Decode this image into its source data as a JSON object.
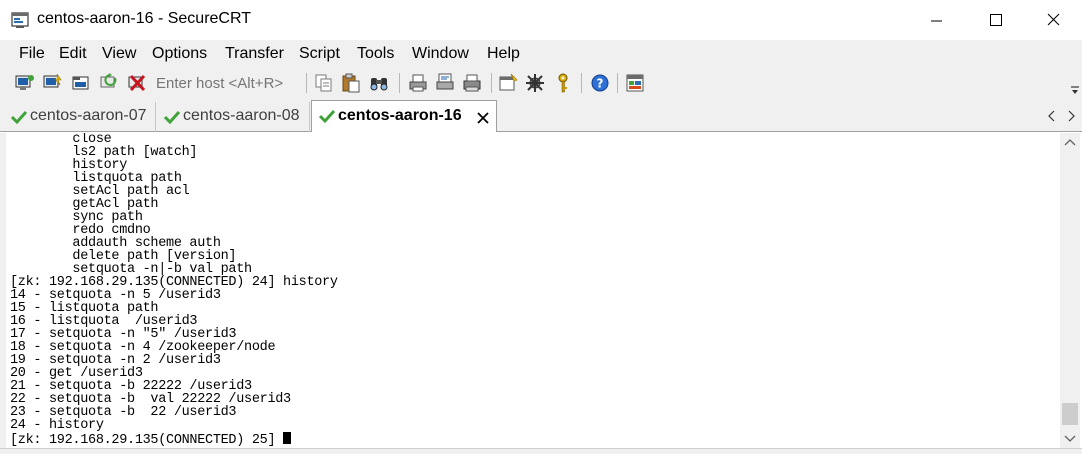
{
  "window": {
    "title": "centos-aaron-16 - SecureCRT"
  },
  "menu": [
    "File",
    "Edit",
    "View",
    "Options",
    "Transfer",
    "Script",
    "Tools",
    "Window",
    "Help"
  ],
  "toolbar": {
    "host_placeholder": "Enter host <Alt+R>"
  },
  "tabs": [
    {
      "label": "centos-aaron-07",
      "active": false,
      "connected": true
    },
    {
      "label": "centos-aaron-08",
      "active": false,
      "connected": true
    },
    {
      "label": "centos-aaron-16",
      "active": true,
      "connected": true
    }
  ],
  "terminal": {
    "lines": [
      "        close",
      "        ls2 path [watch]",
      "        history",
      "        listquota path",
      "        setAcl path acl",
      "        getAcl path",
      "        sync path",
      "        redo cmdno",
      "        addauth scheme auth",
      "        delete path [version]",
      "        setquota -n|-b val path",
      "[zk: 192.168.29.135(CONNECTED) 24] history",
      "14 - setquota -n 5 /userid3",
      "15 - listquota path",
      "16 - listquota  /userid3",
      "17 - setquota -n \"5\" /userid3",
      "18 - setquota -n 4 /zookeeper/node",
      "19 - setquota -n 2 /userid3",
      "20 - get /userid3",
      "21 - setquota -b 22222 /userid3",
      "22 - setquota -b  val 22222 /userid3",
      "23 - setquota -b  22 /userid3",
      "24 - history"
    ],
    "prompt": "[zk: 192.168.29.135(CONNECTED) 25] "
  },
  "colors": {
    "check_green": "#3fa33a",
    "chrome": "#f0f0f0"
  }
}
